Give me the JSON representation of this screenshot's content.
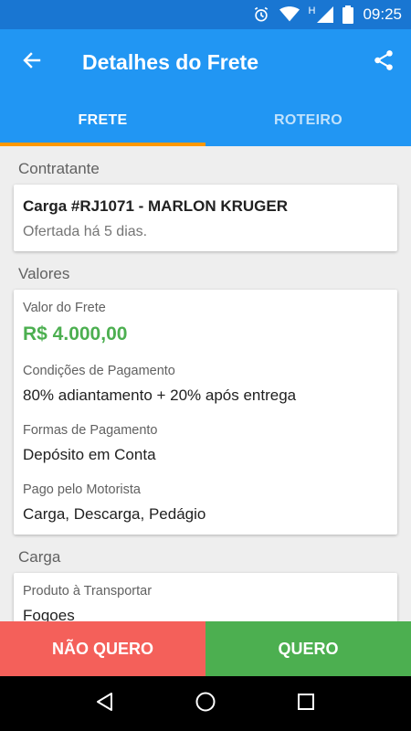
{
  "status_bar": {
    "time": "09:25",
    "network_label": "H"
  },
  "app_bar": {
    "title": "Detalhes do Frete"
  },
  "tabs": [
    {
      "label": "FRETE",
      "active": true
    },
    {
      "label": "ROTEIRO",
      "active": false
    }
  ],
  "contratante": {
    "section_title": "Contratante",
    "headline": "Carga #RJ1071 - MARLON KRUGER",
    "subtitle": "Ofertada há 5 dias."
  },
  "valores": {
    "section_title": "Valores",
    "valor_label": "Valor do Frete",
    "valor_value": "R$ 4.000,00",
    "condicoes_label": "Condições de Pagamento",
    "condicoes_value": "80% adiantamento + 20% após entrega",
    "formas_label": "Formas de Pagamento",
    "formas_value": "Depósito em Conta",
    "pago_label": "Pago pelo Motorista",
    "pago_value": "Carga, Descarga, Pedágio"
  },
  "carga": {
    "section_title": "Carga",
    "produto_label": "Produto à Transportar",
    "produto_value": "Fogoes"
  },
  "actions": {
    "reject_label": "NÃO QUERO",
    "accept_label": "QUERO"
  },
  "colors": {
    "primary": "#2196f3",
    "status_bar": "#1976d2",
    "tab_indicator": "#ff9800",
    "price": "#4caf50",
    "reject": "#f4605a",
    "accept": "#4caf50"
  },
  "icons": {
    "back": "arrow-left-icon",
    "share": "share-icon",
    "alarm": "alarm-icon",
    "wifi": "wifi-icon",
    "signal": "signal-icon",
    "battery": "battery-icon",
    "nav_back": "triangle-back-icon",
    "nav_home": "circle-home-icon",
    "nav_recents": "square-recents-icon"
  }
}
